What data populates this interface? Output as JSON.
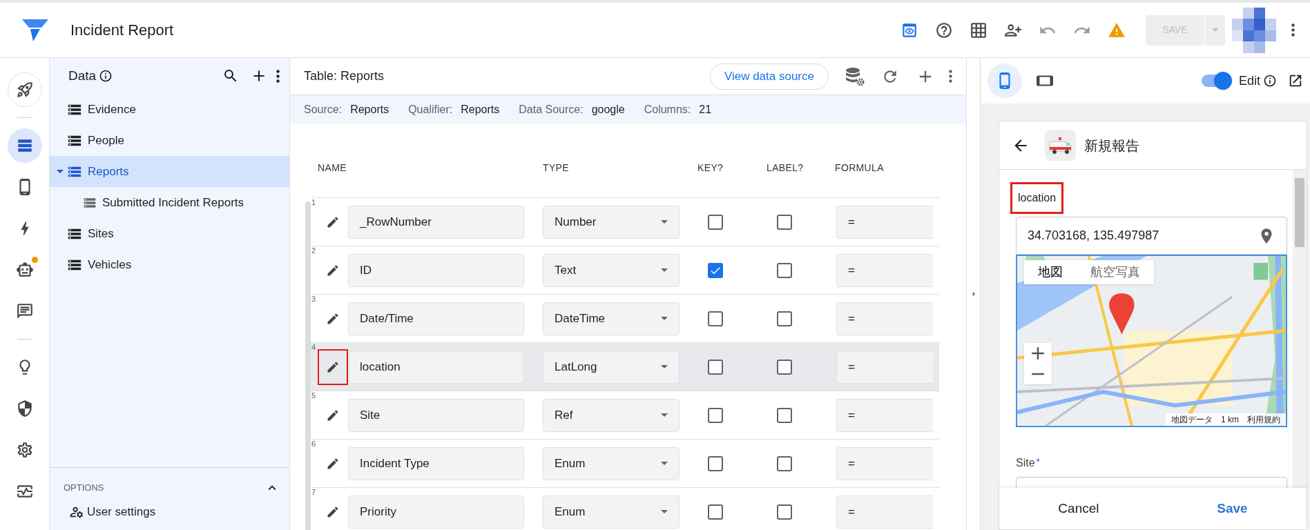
{
  "app": {
    "title": "Incident Report"
  },
  "top_save": {
    "label": "SAVE",
    "disabled": true
  },
  "rail": [
    {
      "kind": "deploy",
      "selected": false,
      "badge": false
    },
    {
      "kind": "data",
      "selected": true,
      "badge": false
    },
    {
      "kind": "views",
      "selected": false,
      "badge": false
    },
    {
      "kind": "actions",
      "selected": false,
      "badge": false
    },
    {
      "kind": "bot",
      "selected": false,
      "badge": true
    },
    {
      "kind": "chat",
      "selected": false,
      "badge": false
    },
    {
      "kind": "intelligence",
      "selected": false,
      "badge": false
    },
    {
      "kind": "security",
      "selected": false,
      "badge": false
    },
    {
      "kind": "settings",
      "selected": false,
      "badge": false
    },
    {
      "kind": "monitor",
      "selected": false,
      "badge": false
    }
  ],
  "data_panel": {
    "title": "Data",
    "tables": [
      {
        "name": "Evidence",
        "selected": false
      },
      {
        "name": "People",
        "selected": false
      },
      {
        "name": "Reports",
        "selected": true,
        "expanded": true,
        "children": [
          {
            "name": "Submitted Incident Reports",
            "selected": false
          }
        ]
      },
      {
        "name": "Sites",
        "selected": false
      },
      {
        "name": "Vehicles",
        "selected": false
      }
    ],
    "options": {
      "title": "OPTIONS",
      "expanded": true,
      "items": [
        "User settings"
      ]
    }
  },
  "table": {
    "title": "Table: Reports",
    "view_source": "View data source",
    "info": [
      {
        "label": "Source:",
        "value": "Reports"
      },
      {
        "label": "Qualifier:",
        "value": "Reports"
      },
      {
        "label": "Data Source:",
        "value": "google"
      },
      {
        "label": "Columns:",
        "value": "21"
      }
    ],
    "columns": [
      "NAME",
      "TYPE",
      "KEY?",
      "LABEL?",
      "FORMULA"
    ],
    "rows": [
      {
        "number": "1",
        "name": "_RowNumber",
        "type": "Number",
        "key": false,
        "label": false,
        "formula": "=",
        "highlighted": false
      },
      {
        "number": "2",
        "name": "ID",
        "type": "Text",
        "key": true,
        "label": false,
        "formula": "=",
        "highlighted": false
      },
      {
        "number": "3",
        "name": "Date/Time",
        "type": "DateTime",
        "key": false,
        "label": false,
        "formula": "=",
        "highlighted": false
      },
      {
        "number": "4",
        "name": "location",
        "type": "LatLong",
        "key": false,
        "label": false,
        "formula": "=",
        "highlighted": true
      },
      {
        "number": "5",
        "name": "Site",
        "type": "Ref",
        "key": false,
        "label": false,
        "formula": "=",
        "highlighted": false
      },
      {
        "number": "6",
        "name": "Incident Type",
        "type": "Enum",
        "key": false,
        "label": false,
        "formula": "=",
        "highlighted": false
      },
      {
        "number": "7",
        "name": "Priority",
        "type": "Enum",
        "key": false,
        "label": false,
        "formula": "=",
        "highlighted": false
      }
    ]
  },
  "preview": {
    "devices": [
      {
        "kind": "phone",
        "selected": true
      },
      {
        "kind": "tablet",
        "selected": false
      }
    ],
    "edit": {
      "label": "Edit",
      "on": true
    },
    "form": {
      "title": "新規報告",
      "fields": [
        {
          "kind": "location",
          "label": "location",
          "highlighted": true,
          "value": "34.703168, 135.497987",
          "map": {
            "types": [
              {
                "label": "地図",
                "selected": true
              },
              {
                "label": "航空写真",
                "selected": false
              }
            ],
            "attribution": [
              "地図データ",
              "1 km",
              "利用規約"
            ]
          }
        },
        {
          "kind": "ref",
          "label": "Site",
          "highlighted": false,
          "required_mark": "*"
        }
      ],
      "cancel": "Cancel",
      "save": "Save"
    }
  }
}
